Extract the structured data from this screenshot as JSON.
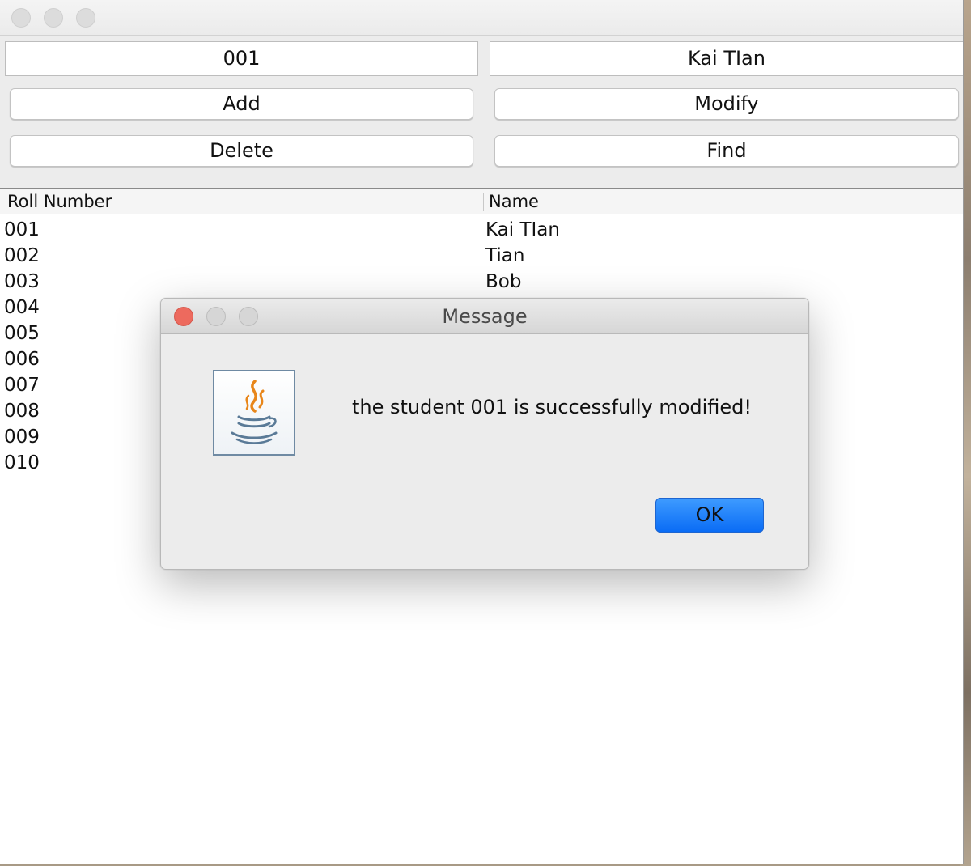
{
  "fields": {
    "roll_number": "001",
    "name": "Kai TIan"
  },
  "buttons": {
    "add": "Add",
    "modify": "Modify",
    "delete": "Delete",
    "find": "Find"
  },
  "table": {
    "columns": [
      "Roll Number",
      "Name"
    ],
    "rows": [
      [
        "001",
        "Kai TIan"
      ],
      [
        "002",
        "Tian"
      ],
      [
        "003",
        "Bob"
      ],
      [
        "004",
        ""
      ],
      [
        "005",
        ""
      ],
      [
        "006",
        ""
      ],
      [
        "007",
        ""
      ],
      [
        "008",
        ""
      ],
      [
        "009",
        ""
      ],
      [
        "010",
        ""
      ]
    ]
  },
  "dialog": {
    "title": "Message",
    "message": "the student 001 is successfully modified!",
    "ok_label": "OK",
    "icon": "java-icon"
  },
  "colors": {
    "close_red": "#ed6a5e",
    "ok_blue": "#1a7cf7"
  }
}
